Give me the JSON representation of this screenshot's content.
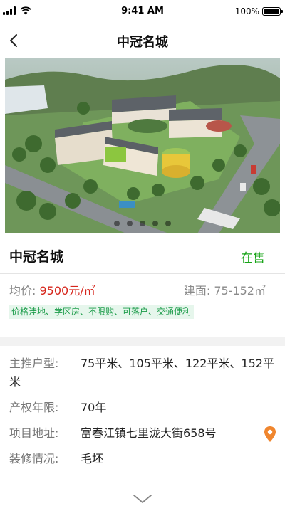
{
  "status_bar": {
    "time": "9:41 AM",
    "battery_text": "100%",
    "icons": [
      "signal-icon",
      "wifi-icon",
      "battery-icon"
    ]
  },
  "nav": {
    "title": "中冠名城",
    "back_icon": "chevron-left-icon"
  },
  "hero": {
    "image_subject": "aerial rendering of school campus",
    "slide_count": 5
  },
  "project": {
    "name": "中冠名城",
    "status": "在售",
    "status_color": "#18a418"
  },
  "price": {
    "label": "均价:",
    "value": "9500元/㎡",
    "value_color": "#d6261c",
    "area_label": "建面:",
    "area_value": "75-152㎡"
  },
  "tags_text": "价格洼地、学区房、不限购、可落户、交通便利",
  "details": {
    "layout_label": "主推户型:",
    "layout_value": "75平米、105平米、122平米、152平米",
    "tenure_label": "产权年限:",
    "tenure_value": "70年",
    "address_label": "项目地址:",
    "address_value": "富春江镇七里泷大街658号",
    "decoration_label": "装修情况:",
    "decoration_value": "毛坯",
    "location_icon": "map-pin-icon",
    "location_icon_color": "#f0862e"
  },
  "expand_icon": "chevron-down-icon"
}
